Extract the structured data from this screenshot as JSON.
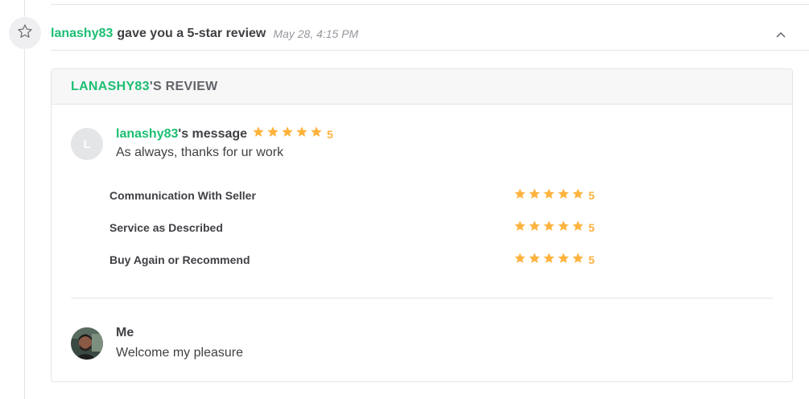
{
  "event": {
    "icon": "star-outline-icon",
    "username": "lanashy83",
    "text": "gave you a 5-star review",
    "time": "May 28, 4:15 PM",
    "collapse_icon": "chevron-up-icon"
  },
  "review": {
    "header_username": "LANASHY83",
    "header_suffix": "'S REVIEW",
    "avatar_initial": "L",
    "message_username": "lanashy83",
    "message_suffix": "'s message",
    "rating": 5,
    "rating_label": "5",
    "message": "As always, thanks for ur work",
    "criteria": [
      {
        "label": "Communication With Seller",
        "rating": 5,
        "score": "5"
      },
      {
        "label": "Service as Described",
        "rating": 5,
        "score": "5"
      },
      {
        "label": "Buy Again or Recommend",
        "rating": 5,
        "score": "5"
      }
    ]
  },
  "reply": {
    "name": "Me",
    "text": "Welcome my pleasure"
  },
  "colors": {
    "accent": "#1dbf73",
    "star": "#ffb33e",
    "text": "#404145",
    "muted": "#95979d",
    "border": "#e4e5e7"
  }
}
